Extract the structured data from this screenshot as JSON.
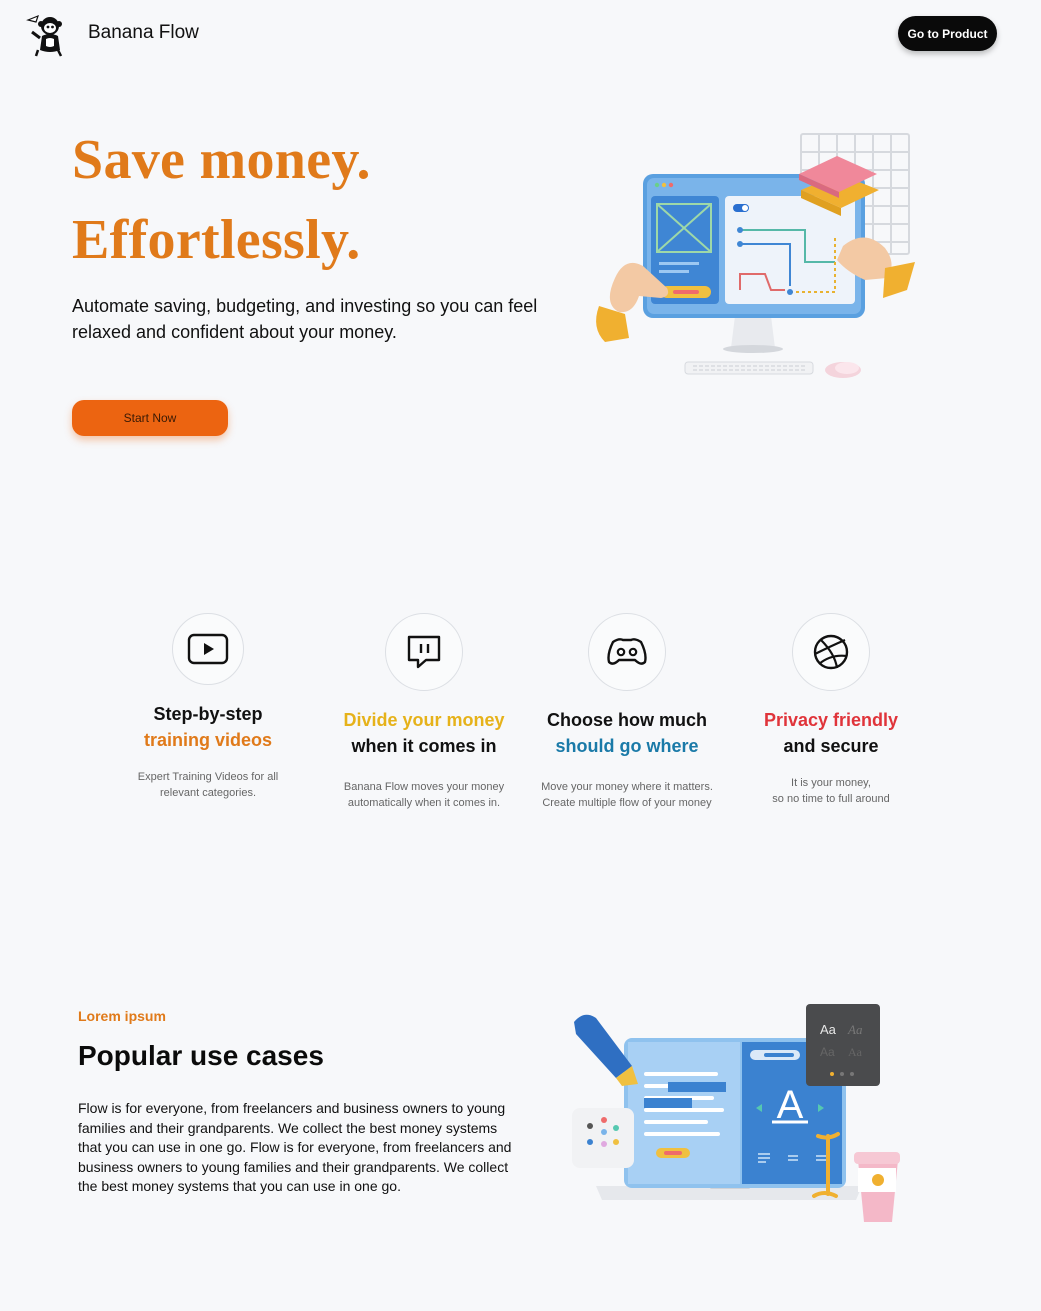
{
  "header": {
    "brand": "Banana Flow",
    "cta_label": "Go to Product"
  },
  "hero": {
    "title_line1": "Save money.",
    "title_line2": "Effortlessly.",
    "subtitle": "Automate saving, budgeting, and investing so you can feel relaxed and confident about your money.",
    "start_label": "Start Now"
  },
  "features": [
    {
      "icon": "play-video-icon",
      "title_black": "Step-by-step",
      "title_colored": "training videos",
      "color": "#e07a1a",
      "desc_line1": "Expert Training Videos for all",
      "desc_line2": "relevant categories."
    },
    {
      "icon": "chat-bubble-icon",
      "title_colored": "Divide your money",
      "title_black": "when it comes in",
      "color": "#e6b21a",
      "desc_line1": "Banana Flow moves your money",
      "desc_line2": "automatically when it comes in."
    },
    {
      "icon": "controller-icon",
      "title_black": "Choose how much",
      "title_colored": "should go where",
      "color": "#1a7aa8",
      "desc_line1": "Move your money where it matters.",
      "desc_line2": "Create multiple flow of your money"
    },
    {
      "icon": "dribbble-ball-icon",
      "title_colored": "Privacy friendly",
      "title_black": "and secure",
      "color": "#e0343a",
      "desc_line1": "It is your money,",
      "desc_line2": "so no time to full around"
    }
  ],
  "use_cases": {
    "eyebrow": "Lorem ipsum",
    "title": "Popular use cases",
    "body": "Flow is for everyone, from freelancers and business owners to young families and their grandparents. We collect the best money systems that you can use in one go. Flow is for everyone, from freelancers and business owners to young families and their grandparents. We collect the best money systems that you can use in one go.",
    "art_text": {
      "letter": "A",
      "font_sample": "Aa"
    }
  },
  "colors": {
    "accent_orange": "#e07a1a",
    "button_orange": "#ec6411",
    "dark": "#0a0a0a"
  }
}
